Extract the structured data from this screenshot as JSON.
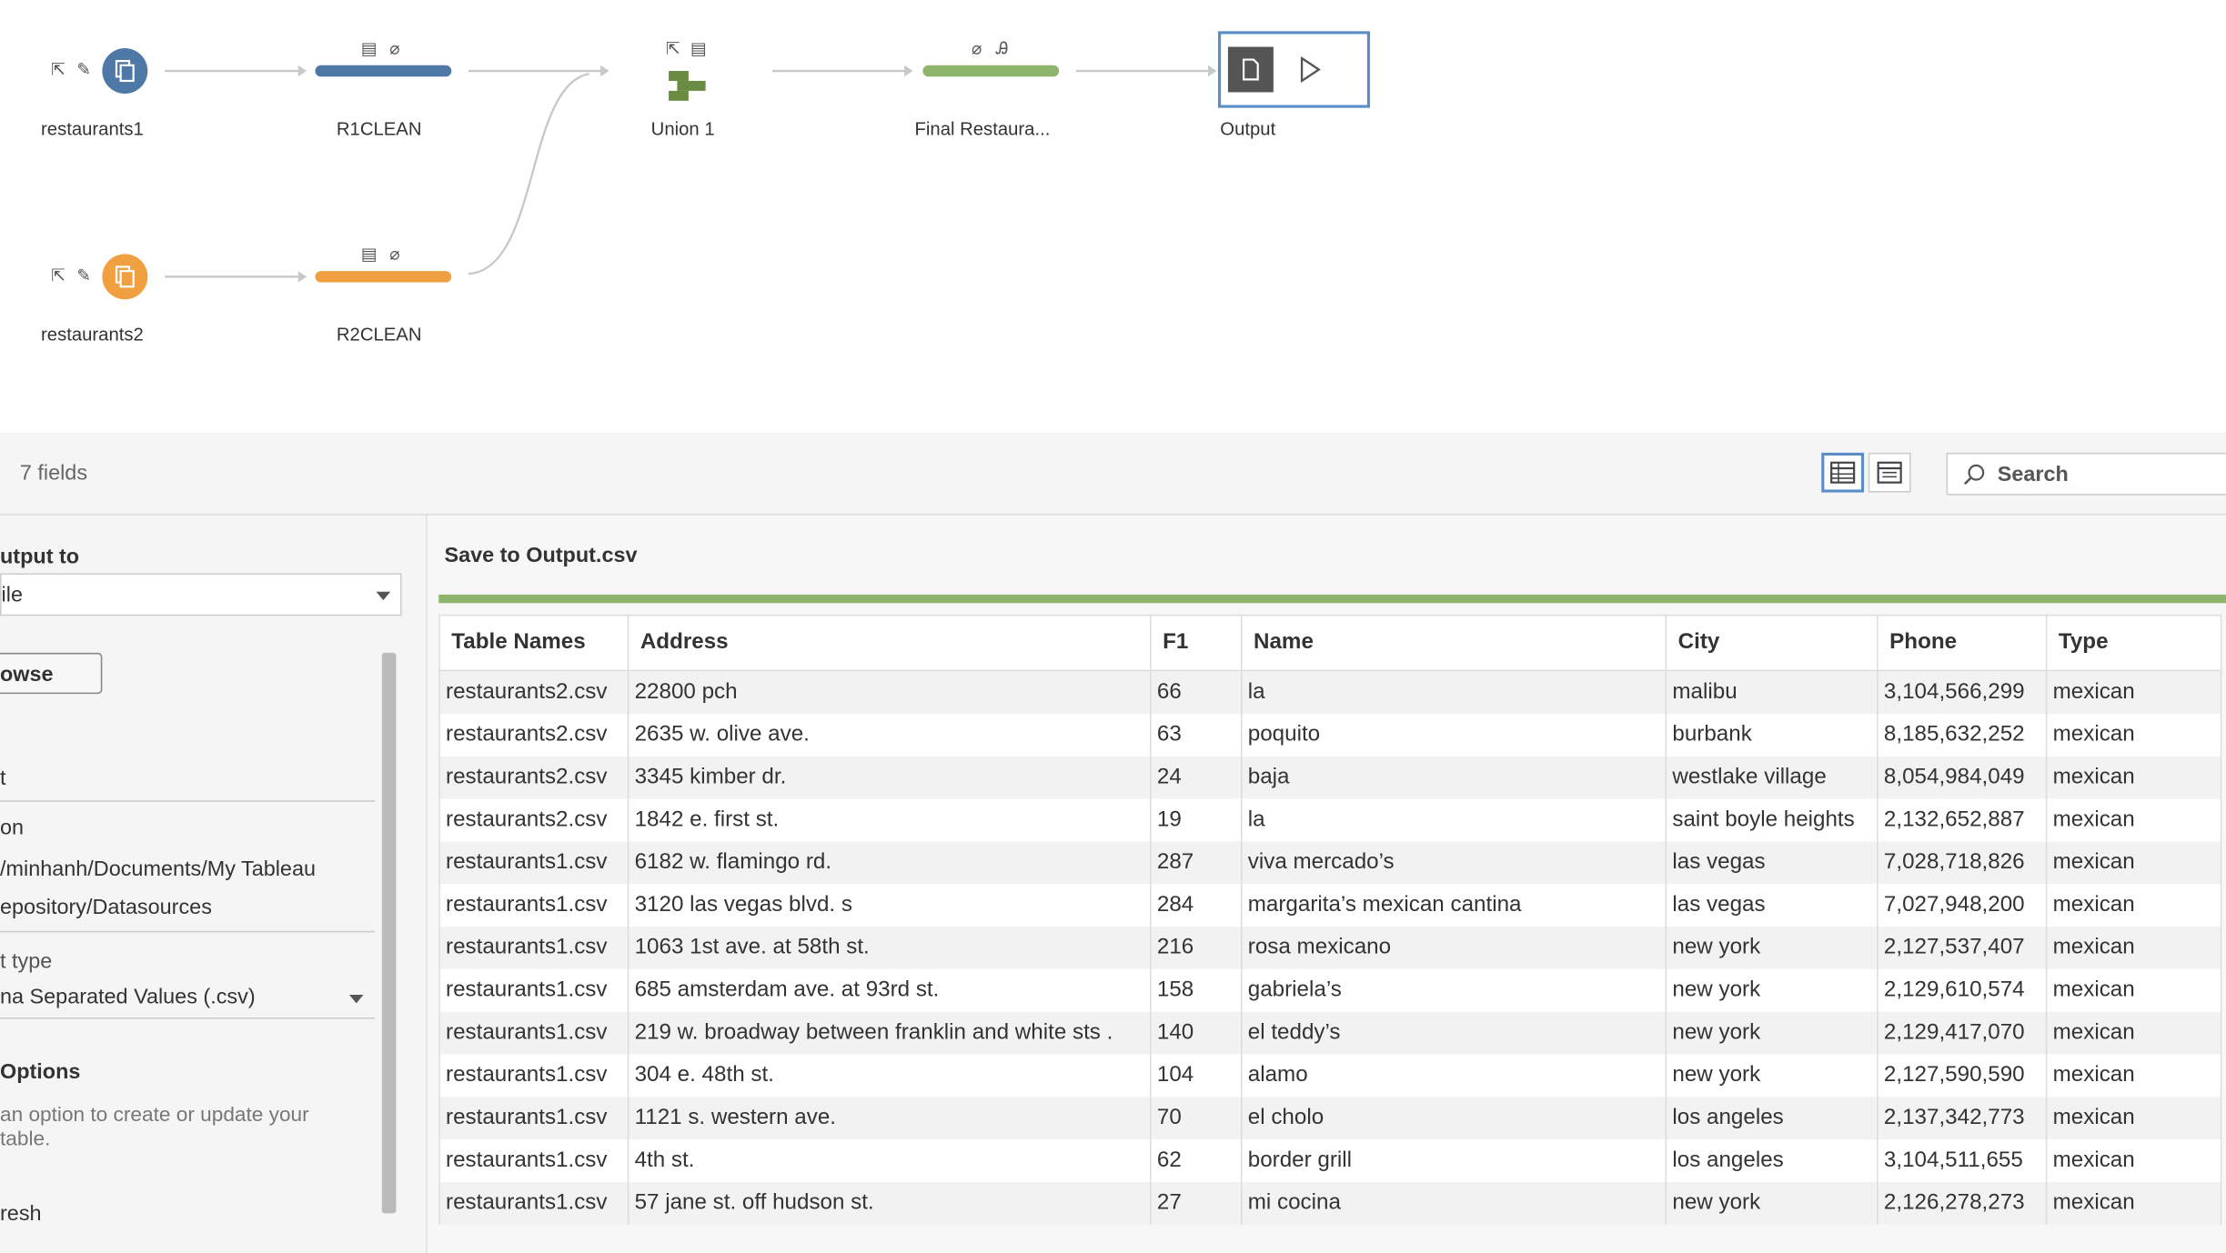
{
  "flow": {
    "nodes": {
      "restaurants1": "restaurants1",
      "restaurants2": "restaurants2",
      "r1clean": "R1CLEAN",
      "r2clean": "R2CLEAN",
      "union": "Union 1",
      "final": "Final Restaura...",
      "output": "Output"
    },
    "colors": {
      "blue": "#4e79a7",
      "orange": "#f0a040",
      "green": "#8fb56c",
      "union_green": "#6a8c42"
    }
  },
  "toolbar": {
    "fields_count": "7 fields",
    "search_label": "Search"
  },
  "left_pane": {
    "output_to_label": "utput to",
    "output_to_value": "ile",
    "browse_label": "owse",
    "name_label": "t",
    "location_label": "on",
    "path_line1": "/minhanh/Documents/My Tableau",
    "path_line2": "epository/Datasources",
    "type_label": "t type",
    "type_value": "na Separated Values (.csv)",
    "options_label": "Options",
    "options_desc1": "an option to create or update your",
    "options_desc2": " table.",
    "refresh_label": "resh"
  },
  "right_pane": {
    "save_title": "Save to Output.csv"
  },
  "table": {
    "columns": [
      "Table Names",
      "Address",
      "F1",
      "Name",
      "City",
      "Phone",
      "Type"
    ],
    "rows": [
      [
        "restaurants2.csv",
        "22800 pch",
        "66",
        "la",
        "malibu",
        "3,104,566,299",
        "mexican"
      ],
      [
        "restaurants2.csv",
        "2635 w. olive ave.",
        "63",
        "poquito",
        "burbank",
        "8,185,632,252",
        "mexican"
      ],
      [
        "restaurants2.csv",
        "3345 kimber dr.",
        "24",
        "baja",
        "westlake village",
        "8,054,984,049",
        "mexican"
      ],
      [
        "restaurants2.csv",
        "1842 e. first st.",
        "19",
        "la",
        "saint boyle heights",
        "2,132,652,887",
        "mexican"
      ],
      [
        "restaurants1.csv",
        "6182 w. flamingo rd.",
        "287",
        "viva mercado’s",
        "las vegas",
        "7,028,718,826",
        "mexican"
      ],
      [
        "restaurants1.csv",
        "3120 las vegas blvd. s",
        "284",
        "margarita’s mexican cantina",
        "las vegas",
        "7,027,948,200",
        "mexican"
      ],
      [
        "restaurants1.csv",
        "1063 1st ave. at 58th st.",
        "216",
        "rosa mexicano",
        "new york",
        "2,127,537,407",
        "mexican"
      ],
      [
        "restaurants1.csv",
        "685 amsterdam ave. at 93rd st.",
        "158",
        "gabriela’s",
        "new york",
        "2,129,610,574",
        "mexican"
      ],
      [
        "restaurants1.csv",
        "219 w. broadway between franklin and white sts .",
        "140",
        "el teddy’s",
        "new york",
        "2,129,417,070",
        "mexican"
      ],
      [
        "restaurants1.csv",
        "304 e. 48th st.",
        "104",
        "alamo",
        "new york",
        "2,127,590,590",
        "mexican"
      ],
      [
        "restaurants1.csv",
        "1121 s. western ave.",
        "70",
        "el cholo",
        "los angeles",
        "2,137,342,773",
        "mexican"
      ],
      [
        "restaurants1.csv",
        "4th st.",
        "62",
        "border grill",
        "los angeles",
        "3,104,511,655",
        "mexican"
      ],
      [
        "restaurants1.csv",
        "57 jane st. off hudson st.",
        "27",
        "mi cocina",
        "new york",
        "2,126,278,273",
        "mexican"
      ]
    ]
  }
}
